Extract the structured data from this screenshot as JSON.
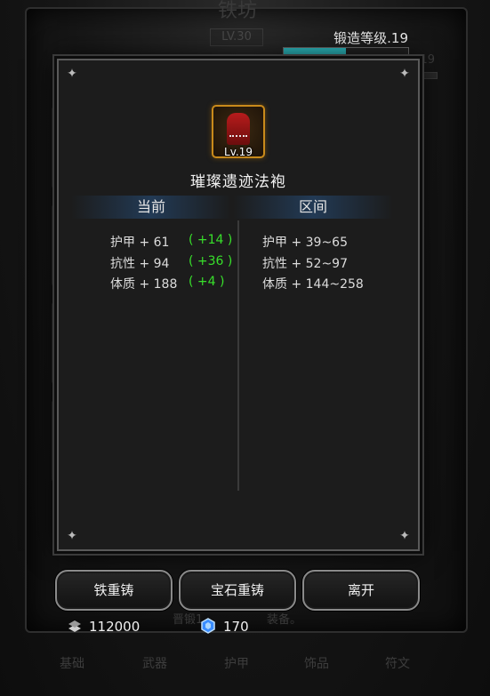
{
  "background": {
    "title": "铁坊",
    "level": "LV.30",
    "side_value": "19",
    "faint_text_left": "晋锻1",
    "faint_text_right": "装备。",
    "tabs": [
      "基础",
      "武器",
      "护甲",
      "饰品",
      "符文"
    ]
  },
  "forge": {
    "label": "锻造等级.19",
    "progress": 0.5
  },
  "item": {
    "level": "Lv.19",
    "name": "璀璨遗迹法袍",
    "icon": "red-robe-icon"
  },
  "columns": {
    "current": "当前",
    "range": "区间"
  },
  "current_stats": [
    {
      "label": "护甲 + 61",
      "bonus": "( +14 )"
    },
    {
      "label": "抗性 + 94",
      "bonus": "( +36 )"
    },
    {
      "label": "体质 + 188",
      "bonus": "( +4 )"
    }
  ],
  "range_stats": [
    {
      "label": "护甲 + 39~65"
    },
    {
      "label": "抗性 + 52~97"
    },
    {
      "label": "体质 + 144~258"
    }
  ],
  "buttons": {
    "iron_reforge": "铁重铸",
    "gem_reforge": "宝石重铸",
    "leave": "离开"
  },
  "currency": {
    "iron": "112000",
    "gem": "170"
  },
  "colors": {
    "bonus": "#38e02b",
    "progress": "#2fc2c8",
    "item_border": "#c98a1b"
  }
}
